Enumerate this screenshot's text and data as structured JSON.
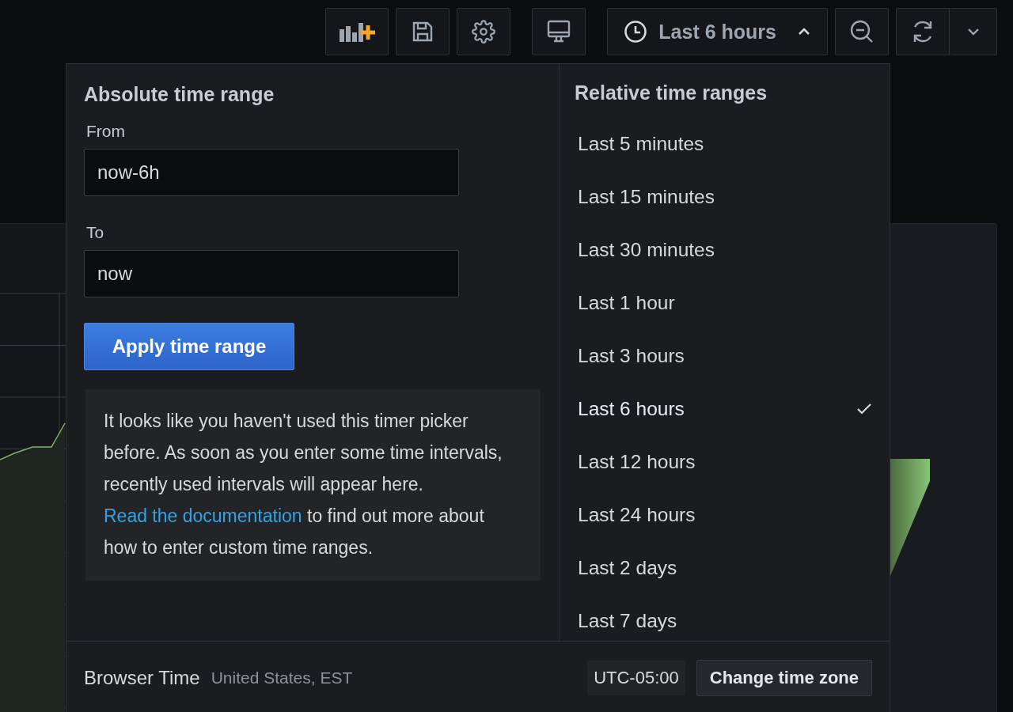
{
  "toolbar": {
    "buttons": [
      {
        "kind": "add-panel"
      },
      {
        "kind": "save"
      },
      {
        "kind": "settings"
      },
      {
        "kind": "tv-mode"
      },
      {
        "kind": "time-range",
        "label": "Last 6 hours",
        "expanded": true
      },
      {
        "kind": "zoom-out"
      },
      {
        "kind": "refresh"
      },
      {
        "kind": "refresh-menu"
      }
    ]
  },
  "time_picker": {
    "absolute": {
      "title": "Absolute time range",
      "from_label": "From",
      "from_value": "now-6h",
      "to_label": "To",
      "to_value": "now",
      "apply_button": "Apply time range",
      "info_text": "It looks like you haven't used this timer picker before. As soon as you enter some time intervals, recently used intervals will appear here.",
      "doc_link": "Read the documentation",
      "doc_text": " to find out more about how to enter custom time ranges."
    },
    "relative": {
      "title": "Relative time ranges",
      "items": [
        {
          "label": "Last 5 minutes",
          "selected": false
        },
        {
          "label": "Last 15 minutes",
          "selected": false
        },
        {
          "label": "Last 30 minutes",
          "selected": false
        },
        {
          "label": "Last 1 hour",
          "selected": false
        },
        {
          "label": "Last 3 hours",
          "selected": false
        },
        {
          "label": "Last 6 hours",
          "selected": true
        },
        {
          "label": "Last 12 hours",
          "selected": false
        },
        {
          "label": "Last 24 hours",
          "selected": false
        },
        {
          "label": "Last 2 days",
          "selected": false
        },
        {
          "label": "Last 7 days",
          "selected": false
        }
      ]
    },
    "footer": {
      "title": "Browser Time",
      "location": "United States, EST",
      "offset": "UTC-05:00",
      "change_button": "Change time zone"
    }
  }
}
